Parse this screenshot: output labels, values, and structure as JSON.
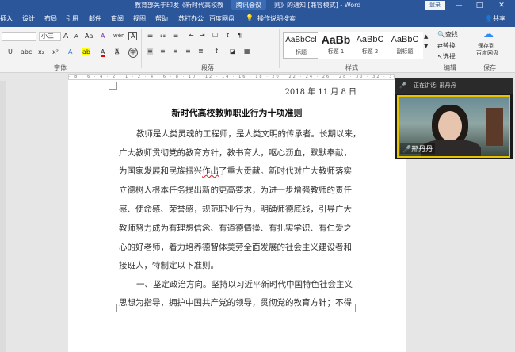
{
  "titlebar": {
    "title": "教育部关于印发《新时代高校教",
    "meeting_tag": "腾讯会议",
    "title_tail": "则》的通知 [兼容模式] - Word",
    "login": "登录",
    "minimize": "—",
    "maximize": "□",
    "close": "✕"
  },
  "tabs": [
    "插入",
    "设计",
    "布局",
    "引用",
    "邮件",
    "审阅",
    "视图",
    "帮助",
    "苏打办公",
    "百度网盘",
    "操作说明搜索"
  ],
  "share": "共享",
  "ribbon": {
    "font_name": "",
    "font_size": "小三",
    "grow": "A",
    "shrink": "A",
    "change_case": "Aa",
    "clear_fmt": "A",
    "phonetic": "wén",
    "border_char": "A",
    "underline": "U",
    "strike": "abc",
    "sub": "x₂",
    "sup": "x²",
    "effects": "A",
    "highlight": "ab",
    "font_color": "A",
    "shade": "A",
    "circle": "字",
    "font_group": "字体",
    "para_group": "段落",
    "style_group": "样式",
    "edit_group": "编辑",
    "save_group": "保存",
    "styles": [
      {
        "preview": "AaBbCcI",
        "name": "标题"
      },
      {
        "preview": "AaBb",
        "name": "标题 1"
      },
      {
        "preview": "AaBbC",
        "name": "标题 2"
      },
      {
        "preview": "AaBbC",
        "name": "副标题"
      }
    ],
    "find": "查找",
    "replace": "替换",
    "select": "选择",
    "save_to": "保存到",
    "cloud": "百度网盘"
  },
  "doc": {
    "date": "2018 年 11 月 8 日",
    "title": "新时代高校教师职业行为十项准则",
    "lines": [
      "教师是人类灵魂的工程师，是人类文明的传承者。长期以来，",
      "广大教师贯彻党的教育方针，教书育人，呕心沥血，默默奉献，",
      "为国家发展和民族振兴",
      "作出",
      "了重大贡献。新时代对广大教师落实",
      "立德树人根本任务提出新的更高要求，为进一步增强教师的责任",
      "感、使命感、荣誉感，规范职业行为，明确师德底线，引导广大",
      "教师努力成为有理想信念、有道德情操、有扎实学识、有仁爱之",
      "心的好老师，着力培养德智体美劳全面发展的社会主义建设者和",
      "接班人，特制定以下准则。",
      "一、坚定政治方向。坚持以习近平新时代中国特色社会主义",
      "思想为指导，拥护中国共产党的领导，贯彻党的教育方针；不得"
    ]
  },
  "meeting": {
    "speaking": "正在讲话: 邢丹丹",
    "name": "邢丹丹"
  }
}
